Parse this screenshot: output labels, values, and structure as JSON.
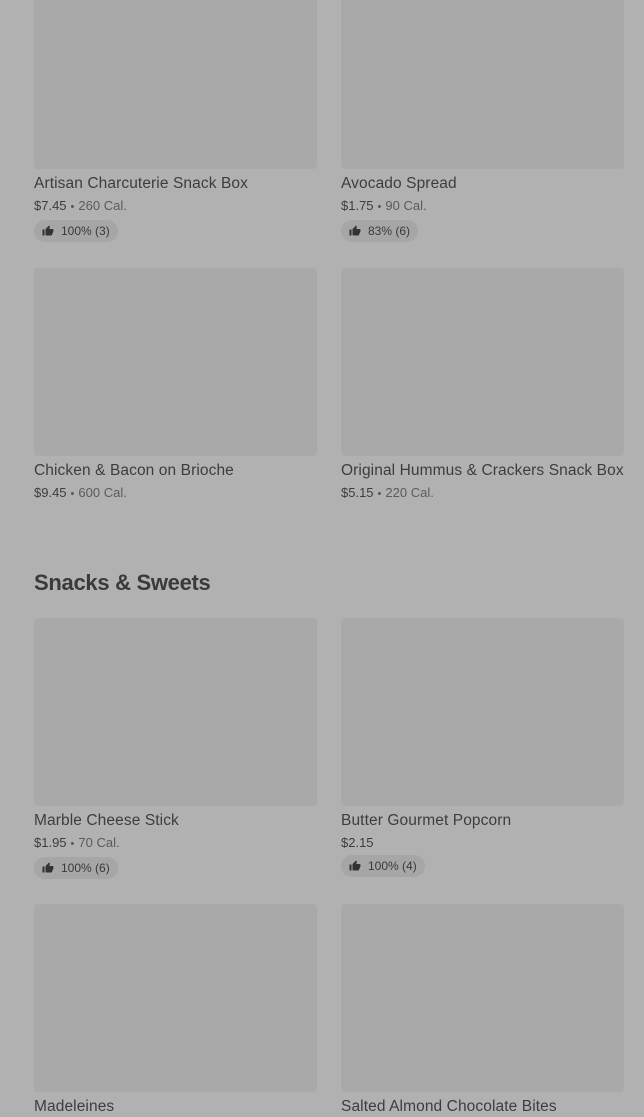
{
  "sections": [
    {
      "items": [
        {
          "name": "Artisan Charcuterie Snack Box",
          "price": "$7.45",
          "calories": "260 Cal.",
          "rating": "100% (3)"
        },
        {
          "name": "Avocado Spread",
          "price": "$1.75",
          "calories": "90 Cal.",
          "rating": "83% (6)"
        },
        {
          "name": "Chicken & Bacon on Brioche",
          "price": "$9.45",
          "calories": "600 Cal."
        },
        {
          "name": "Original Hummus & Crackers Snack Box",
          "price": "$5.15",
          "calories": "220 Cal."
        }
      ]
    },
    {
      "title": "Snacks & Sweets",
      "items": [
        {
          "name": "Marble Cheese Stick",
          "price": "$1.95",
          "calories": "70 Cal.",
          "rating": "100% (6)"
        },
        {
          "name": "Butter Gourmet Popcorn",
          "price": "$2.15",
          "rating": "100% (4)"
        },
        {
          "name": "Madeleines"
        },
        {
          "name": "Salted Almond Chocolate Bites"
        }
      ]
    }
  ],
  "separator": "•"
}
